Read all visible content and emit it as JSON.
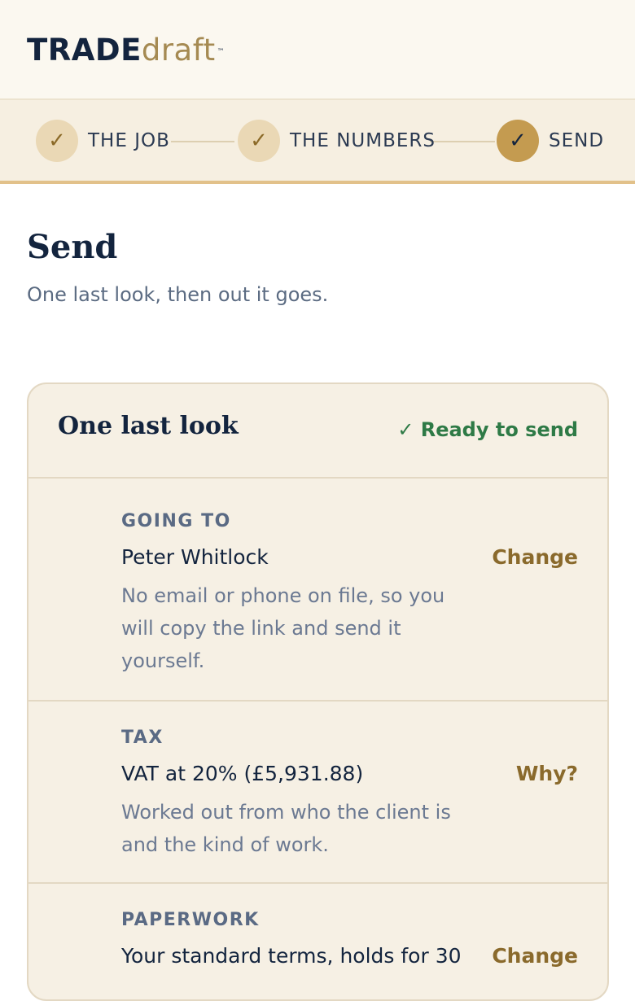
{
  "brand": {
    "bold": "TRADE",
    "light": "draft",
    "tm": "™"
  },
  "steps": [
    {
      "label": "THE JOB",
      "icon": "✓"
    },
    {
      "label": "THE NUMBERS",
      "icon": "✓"
    },
    {
      "label": "SEND",
      "icon": "✓"
    }
  ],
  "page": {
    "title": "Send",
    "subtitle": "One last look, then out it goes."
  },
  "card": {
    "title": "One last look",
    "status": "✓ Ready to send",
    "rows": [
      {
        "label": "GOING TO",
        "value": "Peter Whitlock",
        "note": "No email or phone on file, so you will copy the link and send it yourself.",
        "action": "Change"
      },
      {
        "label": "TAX",
        "value": "VAT at 20% (£5,931.88)",
        "note": "Worked out from who the client is and the kind of work.",
        "action": "Why?"
      },
      {
        "label": "PAPERWORK",
        "value": "Your standard terms, holds for 30",
        "action": "Change"
      }
    ]
  },
  "colors": {
    "accent": "#c49b50",
    "ready": "#2e7a46",
    "action": "#8a6a2c"
  }
}
